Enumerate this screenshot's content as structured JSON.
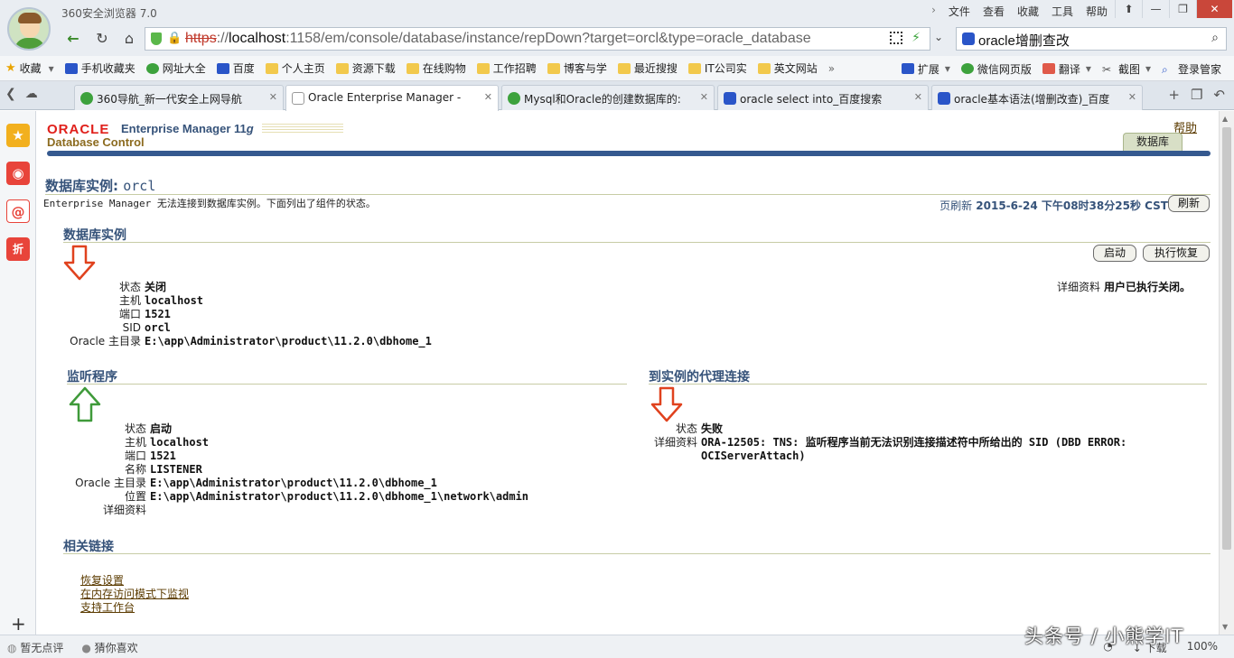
{
  "browser": {
    "app_title": "360安全浏览器 7.0",
    "menu": [
      "文件",
      "查看",
      "收藏",
      "工具",
      "帮助"
    ],
    "window_controls": [
      "⬆",
      "—",
      "❐",
      "✕"
    ],
    "address": {
      "scheme": "https",
      "rest_sep": "://",
      "host": "localhost",
      "path": ":1158/em/console/database/instance/repDown?target=orcl&type=oracle_database"
    },
    "search_text": "oracle增删查改",
    "bookmarks_left": [
      "收藏",
      "手机收藏夹",
      "网址大全",
      "百度",
      "个人主页",
      "资源下载",
      "在线购物",
      "工作招聘",
      "博客与学",
      "最近搜搜",
      "IT公司实",
      "英文网站"
    ],
    "bookmarks_more": "»",
    "bookmarks_right": [
      "扩展",
      "微信网页版",
      "翻译",
      "截图",
      "登录管家"
    ],
    "tabs": [
      {
        "label": "360导航_新一代安全上网导航",
        "color": "#3da23d"
      },
      {
        "label": "Oracle Enterprise Manager -",
        "color": "#ffffff"
      },
      {
        "label": "Mysql和Oracle的创建数据库的:",
        "color": "#3da23d"
      },
      {
        "label": "oracle select into_百度搜索",
        "color": "#2a55c8"
      },
      {
        "label": "oracle基本语法(增删改查)_百度",
        "color": "#2a55c8"
      }
    ],
    "status_left": [
      "暂无点评",
      "猜你喜欢"
    ],
    "status_right": [
      "下载",
      "100%"
    ],
    "watermark": "头条号 / 小熊学IT"
  },
  "em": {
    "logo": "ORACLE",
    "product": "Enterprise Manager 11",
    "product_g": "g",
    "subtitle": "Database Control",
    "help": "帮助",
    "db_tab": "数据库",
    "title_prefix": "数据库实例:",
    "title_name": "orcl",
    "status_msg": "Enterprise Manager 无法连接到数据库实例。下面列出了组件的状态。",
    "refresh_label": "页刷新",
    "refresh_time": "2015-6-24 下午08时38分25秒 CST",
    "refresh_button": "刷新",
    "instance": {
      "title": "数据库实例",
      "start_button": "启动",
      "recover_button": "执行恢复",
      "labels": [
        "状态",
        "主机",
        "端口",
        "SID",
        "Oracle 主目录"
      ],
      "values": [
        "关闭",
        "localhost",
        "1521",
        "orcl",
        "E:\\app\\Administrator\\product\\11.2.0\\dbhome_1"
      ],
      "detail_label": "详细资料",
      "detail_value": "用户已执行关闭。"
    },
    "listener": {
      "title": "监听程序",
      "labels": [
        "状态",
        "主机",
        "端口",
        "名称",
        "Oracle 主目录",
        "位置",
        "详细资料"
      ],
      "values": [
        "启动",
        "localhost",
        "1521",
        "LISTENER",
        "E:\\app\\Administrator\\product\\11.2.0\\dbhome_1",
        "E:\\app\\Administrator\\product\\11.2.0\\dbhome_1\\network\\admin",
        ""
      ]
    },
    "agent": {
      "title": "到实例的代理连接",
      "status_label": "状态",
      "status_value": "失败",
      "detail_label": "详细资料",
      "detail_line1": "ORA-12505: TNS: 监听程序当前无法识别连接描述符中所给出的 SID (DBD ERROR:",
      "detail_line2": "OCIServerAttach)"
    },
    "related": {
      "title": "相关链接",
      "links": [
        "恢复设置",
        "在内存访问模式下监视",
        "支持工作台"
      ]
    }
  },
  "colors": {
    "accent_blue": "#36537a",
    "oracle_red": "#e0201b",
    "arrow_red": "#e0421e",
    "arrow_green": "#3f9a3a"
  }
}
